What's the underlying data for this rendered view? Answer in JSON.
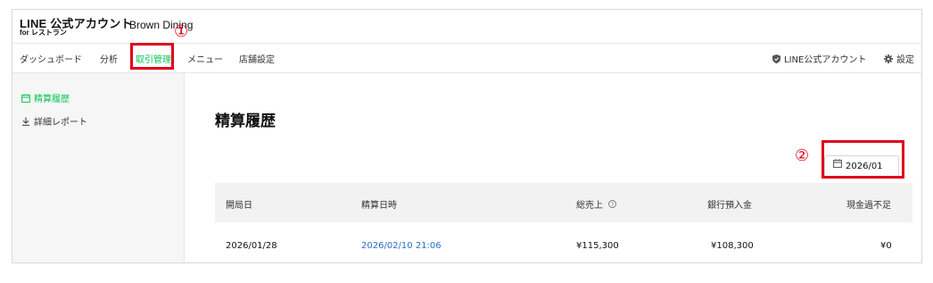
{
  "header": {
    "logo_main": "LINE 公式アカウント",
    "logo_sub": "for レストラン",
    "shop_name": "Brown Dining"
  },
  "nav": {
    "items": [
      {
        "label": "ダッシュボード"
      },
      {
        "label": "分析"
      },
      {
        "label": "取引管理"
      },
      {
        "label": "メニュー"
      },
      {
        "label": "店舗設定"
      }
    ],
    "right": [
      {
        "label": "LINE公式アカウント",
        "icon": "shield-icon"
      },
      {
        "label": "設定",
        "icon": "gear-icon"
      }
    ]
  },
  "sidebar": {
    "items": [
      {
        "label": "精算履歴",
        "icon": "calendar-icon"
      },
      {
        "label": "詳細レポート",
        "icon": "download-icon"
      }
    ]
  },
  "main": {
    "title": "精算履歴",
    "month_value": "2026/01",
    "table": {
      "headers": [
        "開局日",
        "精算日時",
        "総売上",
        "銀行預入金",
        "現金過不足"
      ],
      "rows": [
        [
          "2026/01/28",
          "2026/02/10 21:06",
          "¥115,300",
          "¥108,300",
          "¥0"
        ]
      ]
    }
  },
  "annotations": {
    "callout_1": "①",
    "callout_2": "②"
  },
  "colors": {
    "accent": "#06c755",
    "callout": "#e0001b",
    "link": "#2a6cc4"
  }
}
